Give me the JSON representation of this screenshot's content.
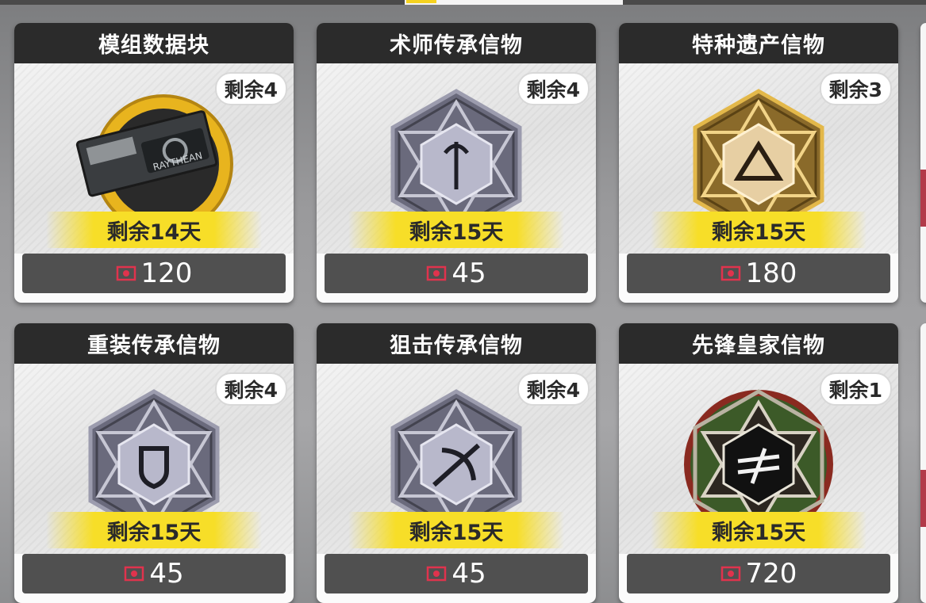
{
  "shop": {
    "items": [
      {
        "name": "模组数据块",
        "remaining": "剩余4",
        "days": "剩余14天",
        "price": "120",
        "emblem": "module-data-icon"
      },
      {
        "name": "术师传承信物",
        "remaining": "剩余4",
        "days": "剩余15天",
        "price": "45",
        "emblem": "caster-token-icon"
      },
      {
        "name": "特种遗产信物",
        "remaining": "剩余3",
        "days": "剩余15天",
        "price": "180",
        "emblem": "specialist-token-icon"
      },
      {
        "name": "重装传承信物",
        "remaining": "剩余4",
        "days": "剩余15天",
        "price": "45",
        "emblem": "defender-token-icon"
      },
      {
        "name": "狙击传承信物",
        "remaining": "剩余4",
        "days": "剩余15天",
        "price": "45",
        "emblem": "sniper-token-icon"
      },
      {
        "name": "先锋皇家信物",
        "remaining": "剩余1",
        "days": "剩余15天",
        "price": "720",
        "emblem": "vanguard-token-icon"
      }
    ],
    "module_label": "RAYTHEAN"
  },
  "colors": {
    "title_bar": "#2b2b2b",
    "days_banner": "#f7de28",
    "price_bar": "#505050",
    "currency": "#e0334d"
  }
}
